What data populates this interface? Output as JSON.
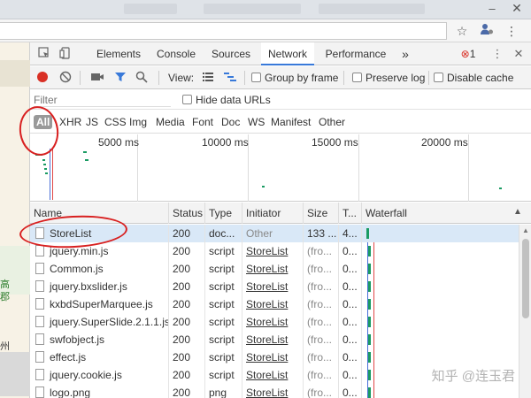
{
  "browser": {
    "minimize_glyph": "–",
    "close_glyph": "✕",
    "star_icon": "star-outline",
    "extension_icon": "person-extension",
    "menu_icon": "vertical-dots"
  },
  "page_left": {
    "text_1": "高",
    "text_2": "郡",
    "text_3": "州"
  },
  "devtools": {
    "tabs": [
      "Elements",
      "Console",
      "Sources",
      "Network",
      "Performance"
    ],
    "active_tab": "Network",
    "more_tabs": "»",
    "error_count": "1",
    "menu_glyph": "⋮",
    "close_glyph": "✕"
  },
  "toolbar": {
    "view_label": "View:",
    "group_by_frame": "Group by frame",
    "preserve_log": "Preserve log",
    "disable_cache": "Disable cache"
  },
  "filter": {
    "placeholder": "Filter",
    "hide_data_urls": "Hide data URLs"
  },
  "types": [
    "All",
    "XHR",
    "JS",
    "CSS",
    "Img",
    "Media",
    "Font",
    "Doc",
    "WS",
    "Manifest",
    "Other"
  ],
  "selected_type": "All",
  "overview": {
    "ticks": [
      "5000 ms",
      "10000 ms",
      "15000 ms",
      "20000 ms"
    ]
  },
  "grid": {
    "headers": {
      "name": "Name",
      "status": "Status",
      "type": "Type",
      "initiator": "Initiator",
      "size": "Size",
      "time": "T...",
      "waterfall": "Waterfall",
      "sort_glyph": "▲"
    },
    "rows": [
      {
        "name": "StoreList",
        "status": "200",
        "type": "doc...",
        "initiator": "Other",
        "size": "133 ...",
        "time": "4..."
      },
      {
        "name": "jquery.min.js",
        "status": "200",
        "type": "script",
        "initiator": "StoreList",
        "size": "(fro...",
        "time": "0..."
      },
      {
        "name": "Common.js",
        "status": "200",
        "type": "script",
        "initiator": "StoreList",
        "size": "(fro...",
        "time": "0..."
      },
      {
        "name": "jquery.bxslider.js",
        "status": "200",
        "type": "script",
        "initiator": "StoreList",
        "size": "(fro...",
        "time": "0..."
      },
      {
        "name": "kxbdSuperMarquee.js",
        "status": "200",
        "type": "script",
        "initiator": "StoreList",
        "size": "(fro...",
        "time": "0..."
      },
      {
        "name": "jquery.SuperSlide.2.1.1.js",
        "status": "200",
        "type": "script",
        "initiator": "StoreList",
        "size": "(fro...",
        "time": "0..."
      },
      {
        "name": "swfobject.js",
        "status": "200",
        "type": "script",
        "initiator": "StoreList",
        "size": "(fro...",
        "time": "0..."
      },
      {
        "name": "effect.js",
        "status": "200",
        "type": "script",
        "initiator": "StoreList",
        "size": "(fro...",
        "time": "0..."
      },
      {
        "name": "jquery.cookie.js",
        "status": "200",
        "type": "script",
        "initiator": "StoreList",
        "size": "(fro...",
        "time": "0..."
      },
      {
        "name": "logo.png",
        "status": "200",
        "type": "png",
        "initiator": "StoreList",
        "size": "(fro...",
        "time": "0..."
      }
    ]
  },
  "watermark": "知乎 @连玉君",
  "colors": {
    "record": "#d93025",
    "filter_blue": "#3879d9",
    "waterfall_green": "#1a9b63",
    "annotation_red": "#d82020",
    "selected_row": "#d9e8f7"
  }
}
